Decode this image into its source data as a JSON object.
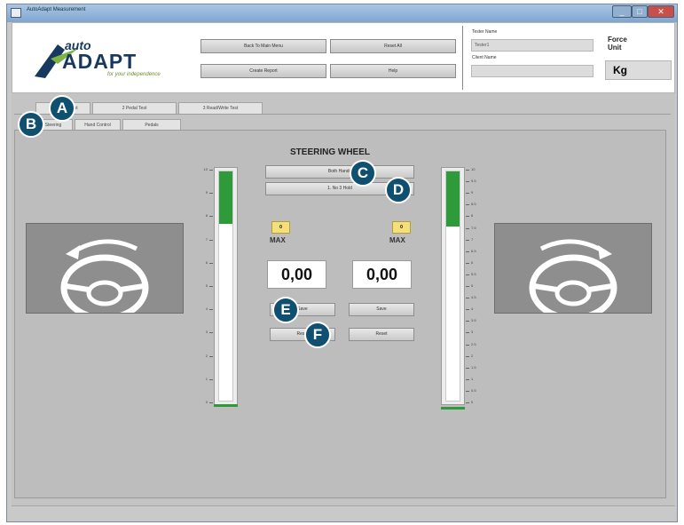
{
  "window": {
    "title": "AutoAdapt Measurement"
  },
  "logo": {
    "top": "auto",
    "main": "ADAPT",
    "tagline": "for your independence"
  },
  "header": {
    "buttons": [
      "Back To Main Menu",
      "Reset All",
      "Create Report",
      "Help"
    ],
    "tester_label": "Tester Name",
    "tester_value": "Tester1",
    "client_label": "Client Name",
    "client_value": "",
    "force_label": "Force\nUnit",
    "force_unit": "Kg"
  },
  "tabs": {
    "top": [
      "1 Steering Test",
      "2 Pedal Test",
      "3 Read/Write Test"
    ],
    "sub": [
      "Steering",
      "Hand Control",
      "Pedals"
    ]
  },
  "main": {
    "title": "STEERING WHEEL",
    "button_c": "Both Hands",
    "button_d": "1. No 3 Hold",
    "left": {
      "max_value": "0",
      "max_label": "MAX",
      "value": "0,00",
      "btn_save": "Save",
      "btn_reset": "Reset"
    },
    "right": {
      "max_value": "0",
      "max_label": "MAX",
      "value": "0,00",
      "btn_save": "Save",
      "btn_reset": "Reset"
    },
    "left_gauge_level": 0.23,
    "right_gauge_level": 0.24,
    "left_ticks": [
      "10",
      "9",
      "8",
      "7",
      "6",
      "5",
      "4",
      "3",
      "2",
      "1",
      "0"
    ],
    "right_ticks": [
      "10",
      "9.5",
      "9",
      "8.5",
      "8",
      "7.5",
      "7",
      "6.5",
      "6",
      "5.5",
      "5",
      "4.5",
      "4",
      "3.5",
      "3",
      "2.5",
      "2",
      "1.5",
      "1",
      "0.5",
      "0"
    ]
  },
  "callouts": [
    "A",
    "B",
    "C",
    "D",
    "E",
    "F"
  ],
  "colors": {
    "gauge_fill": "#2e9a3a",
    "callout": "#0f4f70",
    "max_box": "#f4e07a",
    "title_bar": "#7ea6d0"
  }
}
